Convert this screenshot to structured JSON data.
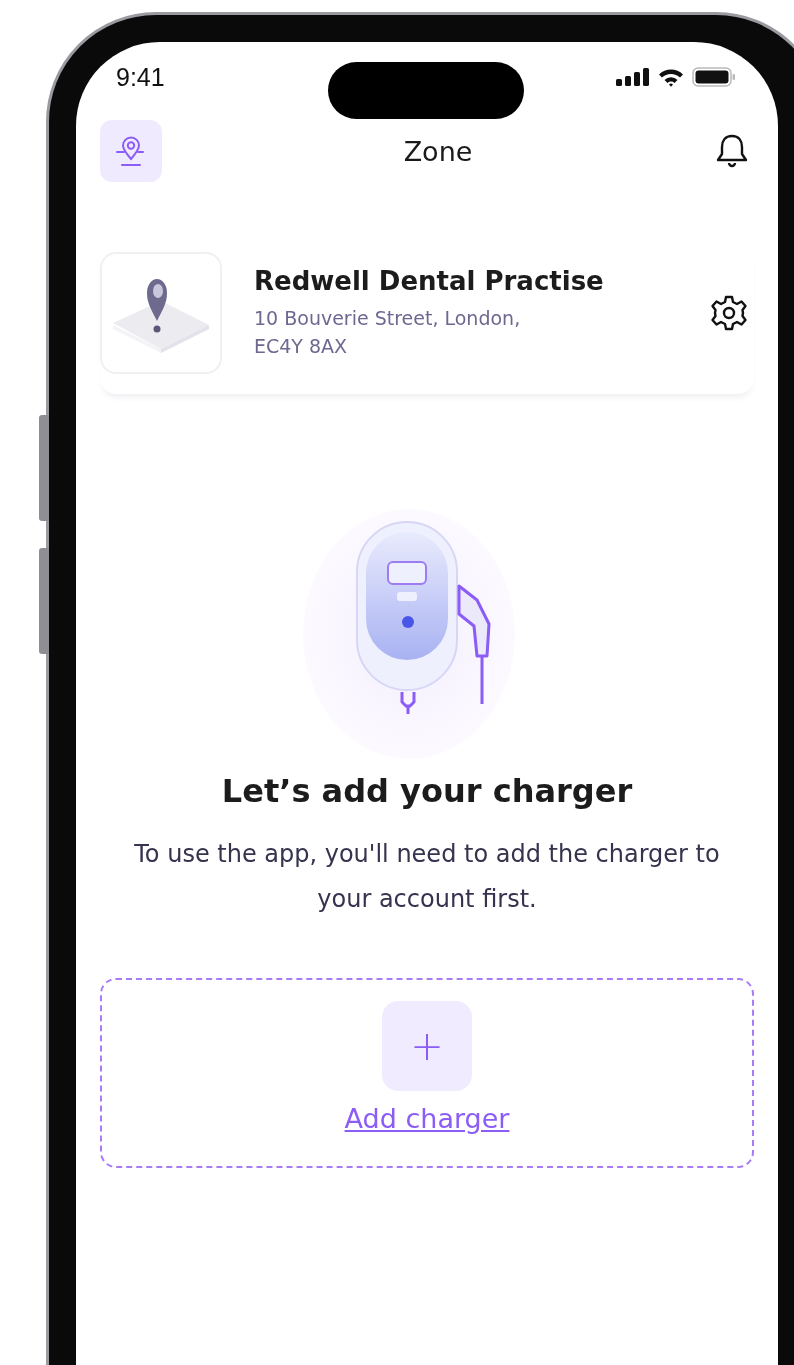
{
  "status_bar": {
    "time": "9:41"
  },
  "header": {
    "title": "Zone"
  },
  "location": {
    "name": "Redwell Dental Practise",
    "address_lines": [
      "10 Bouverie Street, London,",
      "EC4Y 8AX"
    ]
  },
  "empty_state": {
    "title": "Let’s add your charger",
    "description": "To use the app, you'll need to add the charger to your account first."
  },
  "add_charger": {
    "plus": "+",
    "label": "Add charger"
  }
}
